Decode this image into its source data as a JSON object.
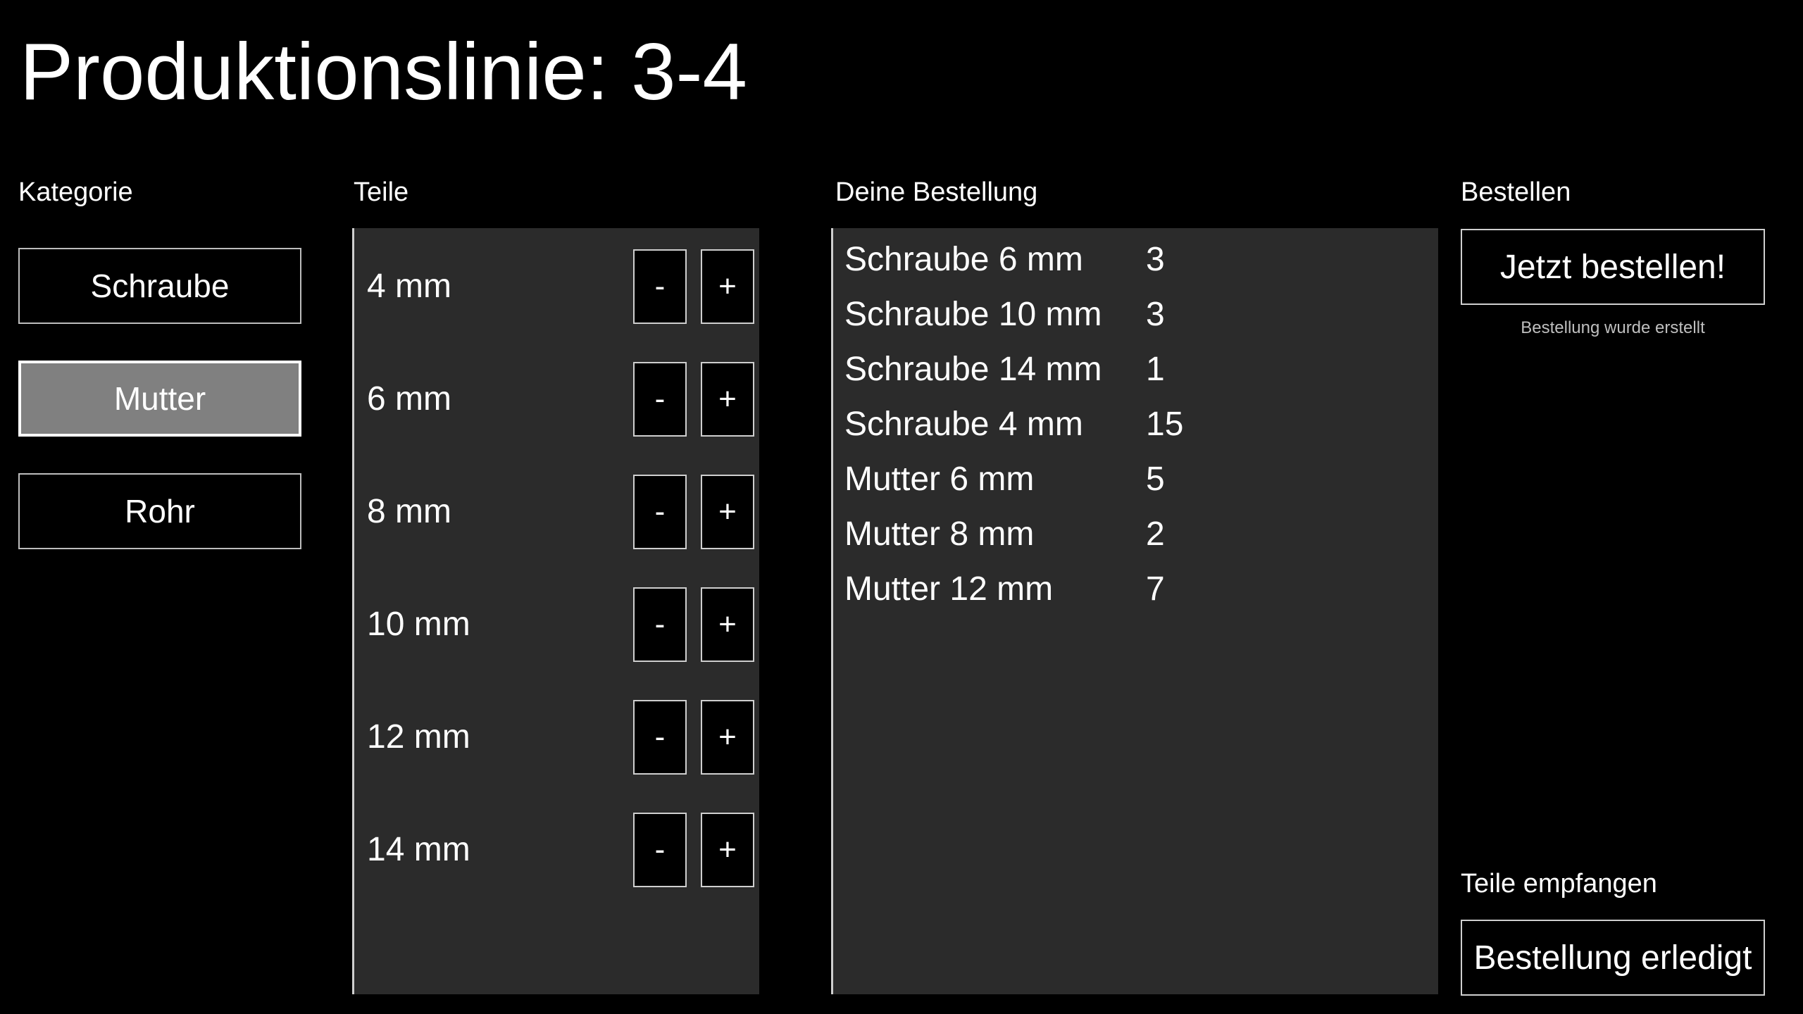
{
  "header": {
    "title": "Produktionslinie: 3-4"
  },
  "kategorie": {
    "label": "Kategorie",
    "items": [
      {
        "label": "Schraube",
        "active": false
      },
      {
        "label": "Mutter",
        "active": true
      },
      {
        "label": "Rohr",
        "active": false
      }
    ]
  },
  "teile": {
    "label": "Teile",
    "minus_label": "-",
    "plus_label": "+",
    "items": [
      {
        "label": "4 mm"
      },
      {
        "label": "6 mm"
      },
      {
        "label": "8 mm"
      },
      {
        "label": "10 mm"
      },
      {
        "label": "12 mm"
      },
      {
        "label": "14 mm"
      }
    ]
  },
  "bestellung": {
    "label": "Deine Bestellung",
    "items": [
      {
        "name": "Schraube 6 mm",
        "qty": "3"
      },
      {
        "name": "Schraube 10 mm",
        "qty": "3"
      },
      {
        "name": "Schraube 14 mm",
        "qty": "1"
      },
      {
        "name": "Schraube 4 mm",
        "qty": "15"
      },
      {
        "name": "Mutter 6 mm",
        "qty": "5"
      },
      {
        "name": "Mutter 8 mm",
        "qty": "2"
      },
      {
        "name": "Mutter 12 mm",
        "qty": "7"
      }
    ]
  },
  "bestellen": {
    "label": "Bestellen",
    "button_label": "Jetzt bestellen!",
    "status": "Bestellung wurde erstellt"
  },
  "empfangen": {
    "label": "Teile empfangen",
    "button_label": "Bestellung erledigt"
  },
  "colors": {
    "background": "#000000",
    "panel": "#2b2b2b",
    "active_button": "#808080",
    "text": "#ffffff"
  }
}
